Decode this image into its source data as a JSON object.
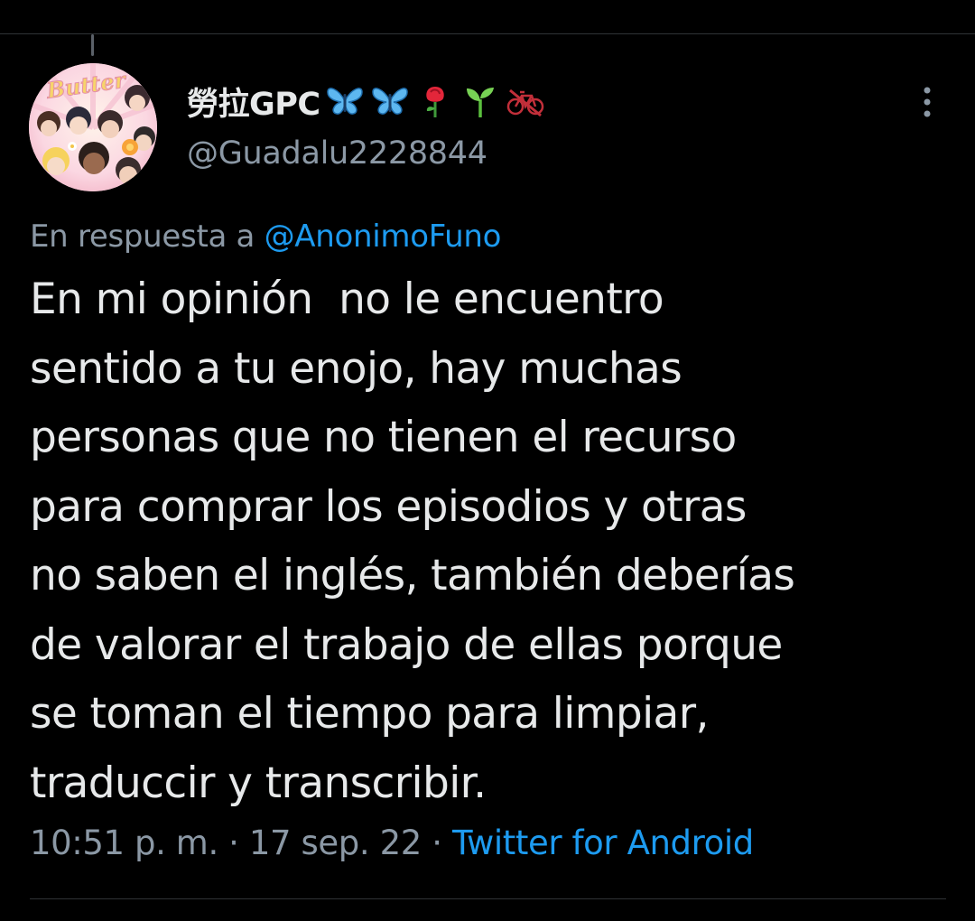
{
  "tweet": {
    "author": {
      "display_name": "勞拉GPC",
      "display_name_emojis": [
        "butterfly-icon",
        "butterfly-icon",
        "rose-icon",
        "seedling-icon",
        "no-bicycles-icon"
      ],
      "handle": "@Guadalu2228844",
      "avatar_text": "Butter"
    },
    "reply": {
      "prefix": "En respuesta a ",
      "mention": "@AnonimoFuno"
    },
    "text_lines": [
      "En mi opinión  no le encuentro",
      "sentido a tu enojo, hay muchas",
      "personas que no tienen el recurso",
      "para comprar los episodios y otras",
      "no saben el inglés, también deberías",
      "de valorar el trabajo de ellas porque",
      "se toman el tiempo para limpiar,",
      "traduccir y transcribir."
    ],
    "meta": {
      "time": "10:51 p. m.",
      "separator": " · ",
      "date": "17 sep. 22",
      "source": "Twitter for Android"
    }
  },
  "colors": {
    "background": "#000000",
    "text_primary": "#e7e9ea",
    "text_secondary": "#8b98a5",
    "link": "#1d9bf0",
    "divider": "#2f3336"
  }
}
